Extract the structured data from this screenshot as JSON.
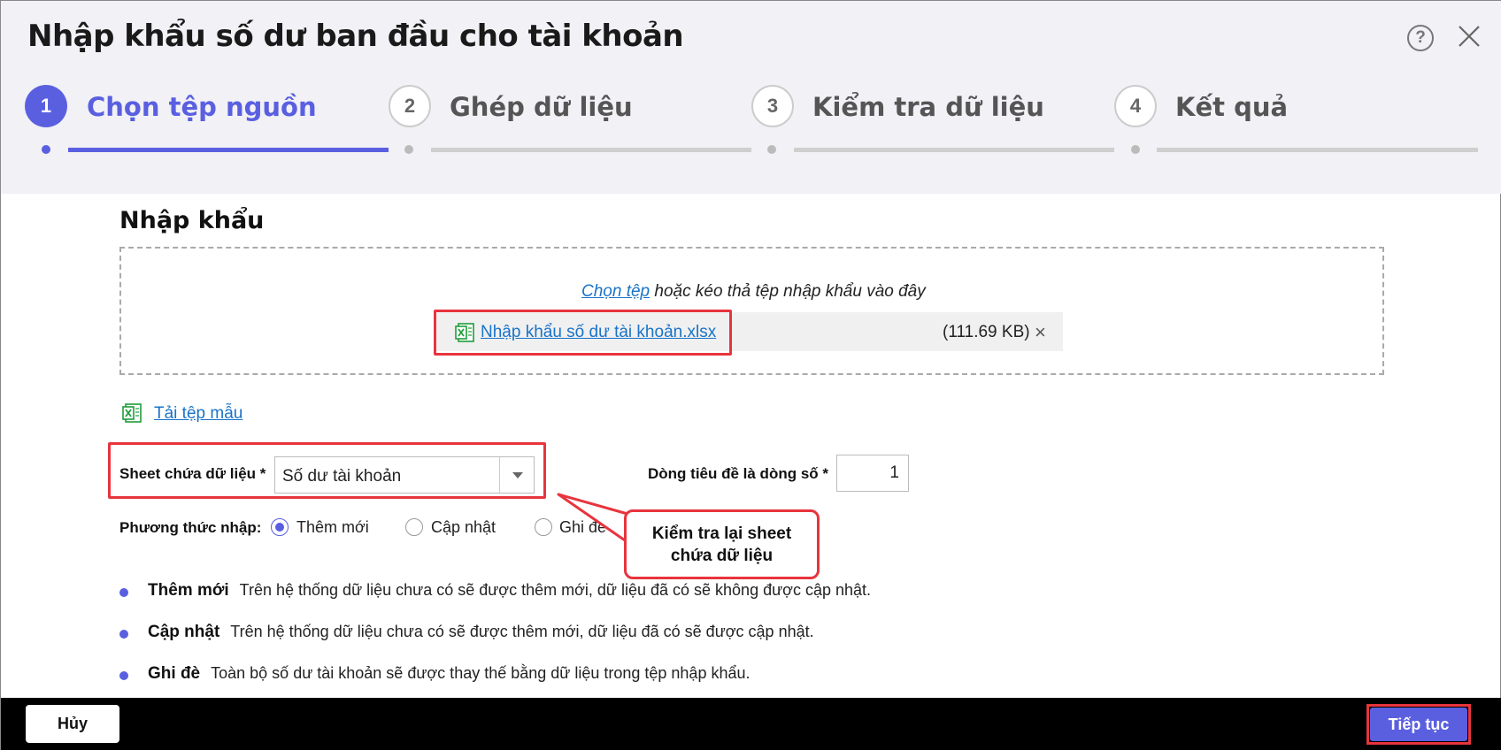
{
  "dialog": {
    "title": "Nhập khẩu số dư ban đầu cho tài khoản",
    "help_icon": "question-circle-icon",
    "close_icon": "close-icon"
  },
  "steps": [
    {
      "number": "1",
      "label": "Chọn tệp nguồn",
      "state": "active"
    },
    {
      "number": "2",
      "label": "Ghép dữ liệu",
      "state": "inactive"
    },
    {
      "number": "3",
      "label": "Kiểm tra dữ liệu",
      "state": "inactive"
    },
    {
      "number": "4",
      "label": "Kết quả",
      "state": "inactive"
    }
  ],
  "import": {
    "section_title": "Nhập khẩu",
    "choose_file_link": "Chọn tệp",
    "drop_hint": "hoặc kéo thả tệp nhập khẩu vào đây",
    "file": {
      "icon": "excel-file-icon",
      "name": "Nhập khẩu số dư tài khoản.xlsx",
      "size": "(111.69 KB)",
      "remove_label": "×"
    },
    "template_link": "Tải tệp mẫu"
  },
  "form": {
    "sheet_label": "Sheet chứa dữ liệu *",
    "sheet_value": "Số dư tài khoản",
    "header_row_label": "Dòng tiêu đề là dòng số *",
    "header_row_value": "1",
    "method_label": "Phương thức nhập:",
    "methods": [
      {
        "label": "Thêm mới",
        "checked": true
      },
      {
        "label": "Cập nhật",
        "checked": false
      },
      {
        "label": "Ghi đè",
        "checked": false
      }
    ]
  },
  "callout": {
    "line1": "Kiểm tra lại sheet",
    "line2": "chứa dữ liệu"
  },
  "descriptions": [
    {
      "title": "Thêm mới",
      "text": "Trên hệ thống dữ liệu chưa có sẽ được thêm mới, dữ liệu đã có sẽ không được cập nhật."
    },
    {
      "title": "Cập nhật",
      "text": "Trên hệ thống dữ liệu chưa có sẽ được thêm mới, dữ liệu đã có sẽ được cập nhật."
    },
    {
      "title": "Ghi đè",
      "text": "Toàn bộ số dư tài khoản sẽ được thay thế bằng dữ liệu trong tệp nhập khẩu."
    }
  ],
  "footer": {
    "cancel_label": "Hủy",
    "next_label": "Tiếp tục"
  },
  "colors": {
    "accent": "#5a5fe0",
    "highlight": "#e8343d",
    "link": "#1a73c8",
    "excel_green": "#1f9d3a"
  }
}
